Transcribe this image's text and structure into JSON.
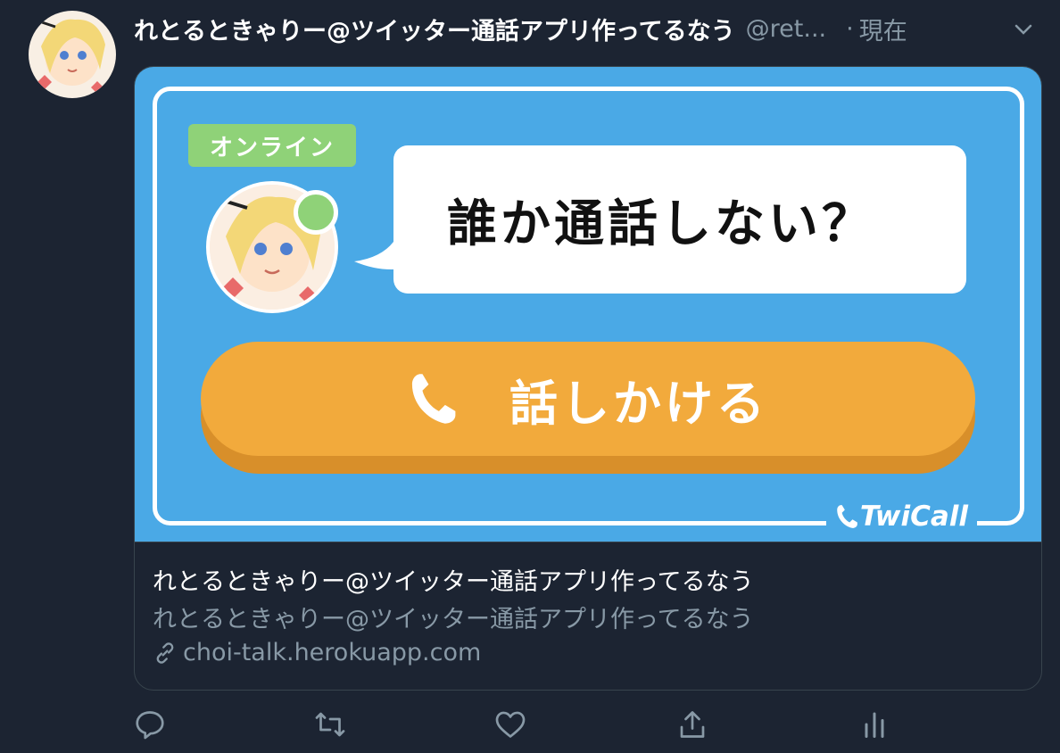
{
  "tweet": {
    "display_name": "れとるときゃりー@ツイッター通話アプリ作ってるなう",
    "handle": "@ret...",
    "separator": "·",
    "time": "現在"
  },
  "card": {
    "image": {
      "online_label": "オンライン",
      "bubble_text": "誰か通話しない？",
      "button_label": "話しかける",
      "brand": "TwiCall",
      "colors": {
        "background": "#4aa9e6",
        "online": "#8fd278",
        "button": "#f2aa3c"
      }
    },
    "title": "れとるときゃりー@ツイッター通話アプリ作ってるなう",
    "description": "れとるときゃりー@ツイッター通話アプリ作ってるなう",
    "domain": "choi-talk.herokuapp.com"
  },
  "icons": {
    "caret": "chevron-down-icon",
    "reply": "reply-icon",
    "retweet": "retweet-icon",
    "like": "heart-icon",
    "share": "share-icon",
    "analytics": "analytics-icon",
    "link": "link-icon",
    "phone": "phone-icon"
  }
}
